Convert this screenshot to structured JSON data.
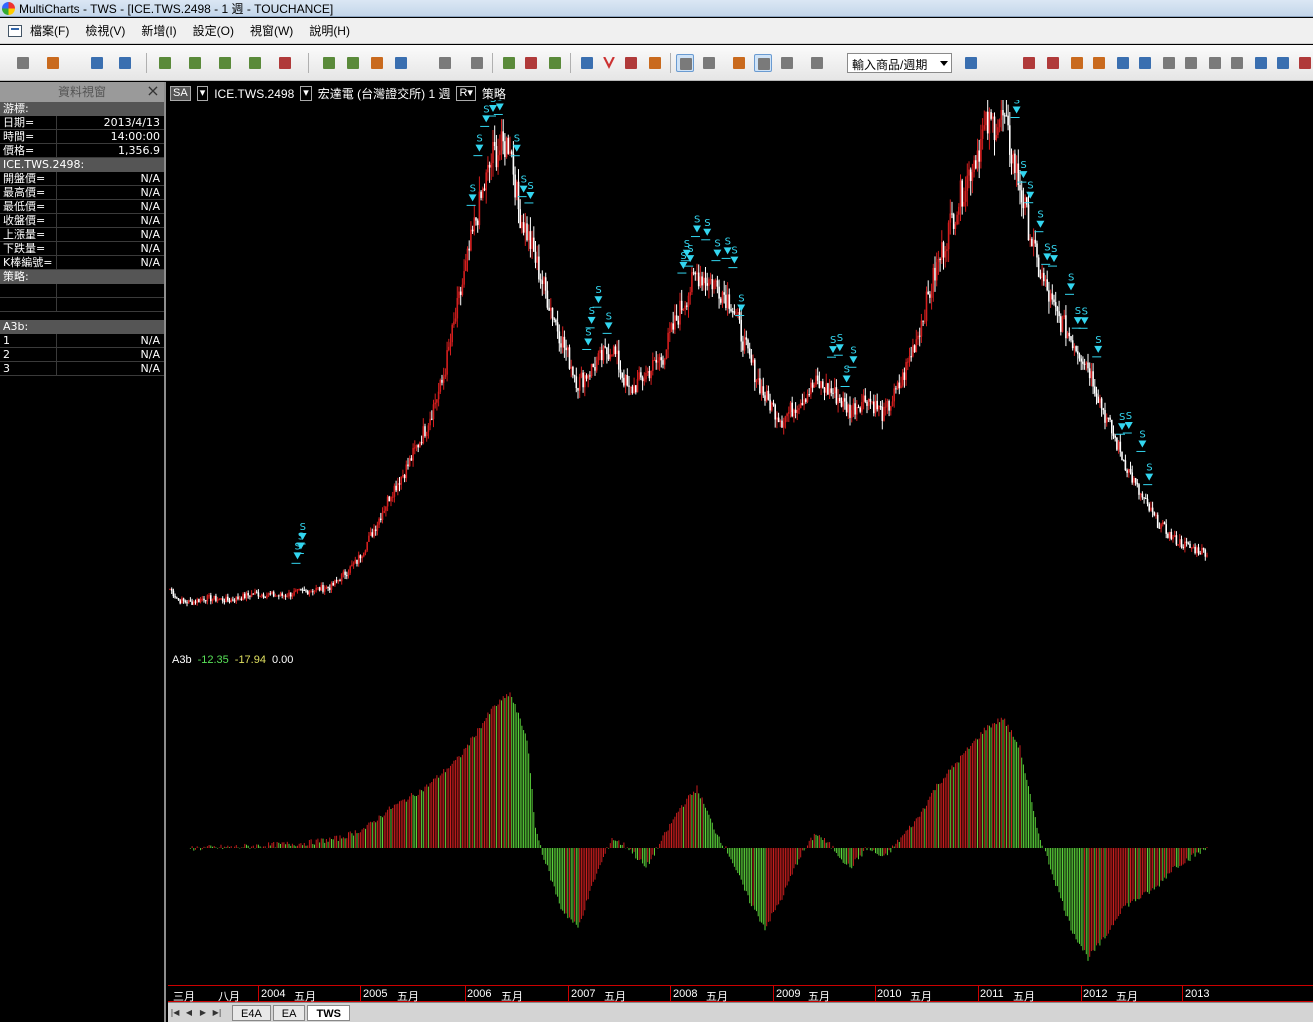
{
  "titlebar": {
    "title": "MultiCharts - TWS - [ICE.TWS.2498 - 1 週 - TOUCHANCE]"
  },
  "menu": [
    "檔案(F)",
    "檢視(V)",
    "新增(I)",
    "設定(O)",
    "視窗(W)",
    "說明(H)"
  ],
  "toolbar": {
    "symbol_select": "輸入商品/週期"
  },
  "datawin": {
    "title": "資料視窗",
    "cursor_section": "游標:",
    "cursor_rows": [
      {
        "k": "日期=",
        "v": "2013/4/13"
      },
      {
        "k": "時間=",
        "v": "14:00:00"
      },
      {
        "k": "價格=",
        "v": "1,356.9"
      }
    ],
    "symbol_section": "ICE.TWS.2498:",
    "symbol_rows": [
      {
        "k": "開盤價=",
        "v": "N/A"
      },
      {
        "k": "最高價=",
        "v": "N/A"
      },
      {
        "k": "最低價=",
        "v": "N/A"
      },
      {
        "k": "收盤價=",
        "v": "N/A"
      },
      {
        "k": "上漲量=",
        "v": "N/A"
      },
      {
        "k": "下跌量=",
        "v": "N/A"
      },
      {
        "k": "K棒編號=",
        "v": "N/A"
      }
    ],
    "strategy_section": "策略:",
    "ind_section": "A3b:",
    "ind_rows": [
      {
        "k": "1",
        "v": "N/A"
      },
      {
        "k": "2",
        "v": "N/A"
      },
      {
        "k": "3",
        "v": "N/A"
      }
    ]
  },
  "chart_header": {
    "sa": "SA",
    "symbol": "ICE.TWS.2498",
    "description": "宏達電 (台灣證交所) 1 週",
    "strategy": "策略"
  },
  "indicator_label": {
    "name": "A3b",
    "v1": "-12.35",
    "v2": "-17.94",
    "v3": "0.00"
  },
  "colors": {
    "up": "#d41e1e",
    "down": "#ffffff",
    "signal": "#33d6f0",
    "hist_up": "#5ad13a",
    "hist_down": "#c81e1e",
    "v1": "#58e258",
    "v2": "#e0e060",
    "v3": "#ffffff"
  },
  "signal_glyph": "S",
  "x_axis": [
    "三月",
    "八月",
    "2004",
    "五月",
    "2005",
    "五月",
    "2006",
    "五月",
    "2007",
    "五月",
    "2008",
    "五月",
    "2009",
    "五月",
    "2010",
    "五月",
    "2011",
    "五月",
    "2012",
    "五月",
    "2013"
  ],
  "tabs": [
    "E4A",
    "EA",
    "TWS"
  ],
  "chart_data": {
    "type": "line",
    "price_keypoints": [
      [
        0,
        270
      ],
      [
        5,
        245
      ],
      [
        12,
        240
      ],
      [
        20,
        250
      ],
      [
        35,
        245
      ],
      [
        50,
        260
      ],
      [
        65,
        255
      ],
      [
        80,
        265
      ],
      [
        95,
        275
      ],
      [
        110,
        330
      ],
      [
        120,
        400
      ],
      [
        130,
        480
      ],
      [
        140,
        540
      ],
      [
        150,
        620
      ],
      [
        160,
        720
      ],
      [
        170,
        900
      ],
      [
        180,
        1080
      ],
      [
        190,
        1220
      ],
      [
        200,
        1250
      ],
      [
        205,
        1100
      ],
      [
        210,
        1050
      ],
      [
        220,
        930
      ],
      [
        230,
        820
      ],
      [
        240,
        720
      ],
      [
        250,
        760
      ],
      [
        260,
        800
      ],
      [
        270,
        700
      ],
      [
        280,
        740
      ],
      [
        290,
        780
      ],
      [
        300,
        880
      ],
      [
        310,
        960
      ],
      [
        320,
        940
      ],
      [
        330,
        900
      ],
      [
        340,
        780
      ],
      [
        350,
        690
      ],
      [
        360,
        640
      ],
      [
        370,
        680
      ],
      [
        380,
        720
      ],
      [
        390,
        700
      ],
      [
        400,
        660
      ],
      [
        410,
        690
      ],
      [
        420,
        650
      ],
      [
        430,
        720
      ],
      [
        440,
        830
      ],
      [
        450,
        960
      ],
      [
        460,
        1080
      ],
      [
        470,
        1180
      ],
      [
        480,
        1280
      ],
      [
        490,
        1300
      ],
      [
        500,
        1150
      ],
      [
        510,
        980
      ],
      [
        520,
        880
      ],
      [
        530,
        820
      ],
      [
        540,
        760
      ],
      [
        550,
        650
      ],
      [
        560,
        560
      ],
      [
        570,
        480
      ],
      [
        580,
        420
      ],
      [
        590,
        380
      ],
      [
        600,
        360
      ],
      [
        610,
        350
      ]
    ],
    "hist_keypoints": [
      [
        0,
        0
      ],
      [
        20,
        0
      ],
      [
        40,
        1
      ],
      [
        60,
        3
      ],
      [
        80,
        5
      ],
      [
        100,
        10
      ],
      [
        115,
        20
      ],
      [
        130,
        40
      ],
      [
        150,
        60
      ],
      [
        170,
        90
      ],
      [
        190,
        140
      ],
      [
        200,
        155
      ],
      [
        210,
        110
      ],
      [
        215,
        20
      ],
      [
        220,
        -10
      ],
      [
        230,
        -60
      ],
      [
        240,
        -80
      ],
      [
        250,
        -30
      ],
      [
        260,
        10
      ],
      [
        270,
        0
      ],
      [
        280,
        -20
      ],
      [
        290,
        10
      ],
      [
        300,
        40
      ],
      [
        310,
        60
      ],
      [
        320,
        20
      ],
      [
        330,
        -10
      ],
      [
        340,
        -50
      ],
      [
        350,
        -80
      ],
      [
        360,
        -50
      ],
      [
        370,
        -10
      ],
      [
        380,
        15
      ],
      [
        390,
        0
      ],
      [
        400,
        -20
      ],
      [
        410,
        0
      ],
      [
        420,
        -10
      ],
      [
        430,
        10
      ],
      [
        440,
        30
      ],
      [
        450,
        60
      ],
      [
        460,
        80
      ],
      [
        470,
        100
      ],
      [
        480,
        120
      ],
      [
        490,
        130
      ],
      [
        500,
        100
      ],
      [
        510,
        20
      ],
      [
        520,
        -30
      ],
      [
        530,
        -80
      ],
      [
        540,
        -110
      ],
      [
        550,
        -90
      ],
      [
        560,
        -60
      ],
      [
        570,
        -50
      ],
      [
        580,
        -40
      ],
      [
        590,
        -20
      ],
      [
        600,
        -10
      ],
      [
        610,
        0
      ]
    ],
    "signal_indices": [
      75,
      77,
      78,
      178,
      182,
      186,
      190,
      194,
      198,
      204,
      208,
      212,
      246,
      248,
      252,
      258,
      302,
      304,
      306,
      310,
      316,
      322,
      328,
      332,
      336,
      390,
      394,
      398,
      402,
      498,
      502,
      506,
      512,
      516,
      520,
      530,
      534,
      538,
      546,
      560,
      564,
      572,
      576
    ]
  }
}
